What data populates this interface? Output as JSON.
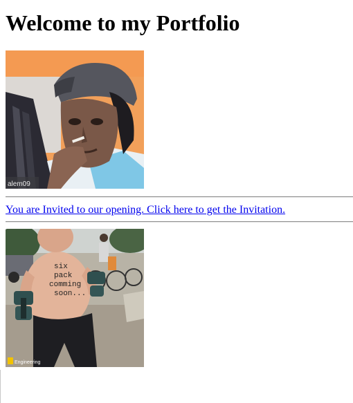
{
  "page": {
    "heading": "Welcome to my Portfolio"
  },
  "images": {
    "top": {
      "watermark": "alem09",
      "icon": "portrait-gif"
    },
    "bottom": {
      "caption_lines": [
        "six",
        "pack",
        "comming",
        "soon..."
      ],
      "watermark_brand": "Engineering",
      "icon": "kid-with-dumbbells-meme"
    }
  },
  "link": {
    "label": "You are Invited to our opening. Click here to get the Invitation."
  },
  "colors": {
    "link": "#0000ee",
    "divider": "#8e8e8e",
    "text": "#000000"
  }
}
